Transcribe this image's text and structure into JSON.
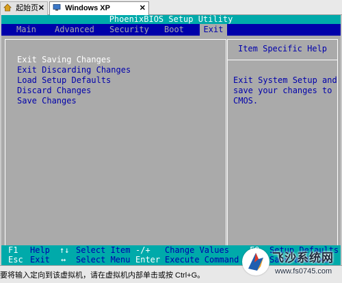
{
  "vm_tabs": {
    "home_label": "起始页",
    "home_close": "✕",
    "vm_label": "Windows XP Professional",
    "vm_close": "✕"
  },
  "bios": {
    "title": "PhoenixBIOS Setup Utility",
    "menu": [
      "Main",
      "Advanced",
      "Security",
      "Boot",
      "Exit"
    ],
    "active_menu": "Exit",
    "exit_options": [
      "Exit Saving Changes",
      "Exit Discarding Changes",
      "Load Setup Defaults",
      "Discard Changes",
      "Save Changes"
    ],
    "selected_option": "Exit Saving Changes",
    "help_title": "Item Specific Help",
    "help_text": "Exit System Setup and\nsave your changes to\nCMOS.",
    "footer_row1": [
      {
        "key": "F1",
        "desc": "Help"
      },
      {
        "key": "↑↓",
        "desc": "Select Item"
      },
      {
        "key": "-/+",
        "desc": "Change Values"
      },
      {
        "key": "F9",
        "desc": "Setup Defaults"
      }
    ],
    "footer_row2": [
      {
        "key": "Esc",
        "desc": "Exit"
      },
      {
        "key": "↔",
        "desc": "Select Menu"
      },
      {
        "key": "Enter",
        "desc": "Execute Command"
      },
      {
        "key": "F10",
        "desc": "Save and Exit"
      }
    ],
    "colors": {
      "bios_gray": "#aaaaaa",
      "bios_blue": "#0000aa",
      "bios_cyan": "#00aaaa",
      "white": "#ffffff"
    }
  },
  "statusbar": {
    "text": "要将输入定向到该虚拟机，请在虚拟机内部单击或按 Ctrl+G。"
  },
  "watermark": {
    "title": "飞沙系统网",
    "url": "www.fs0745.com"
  }
}
